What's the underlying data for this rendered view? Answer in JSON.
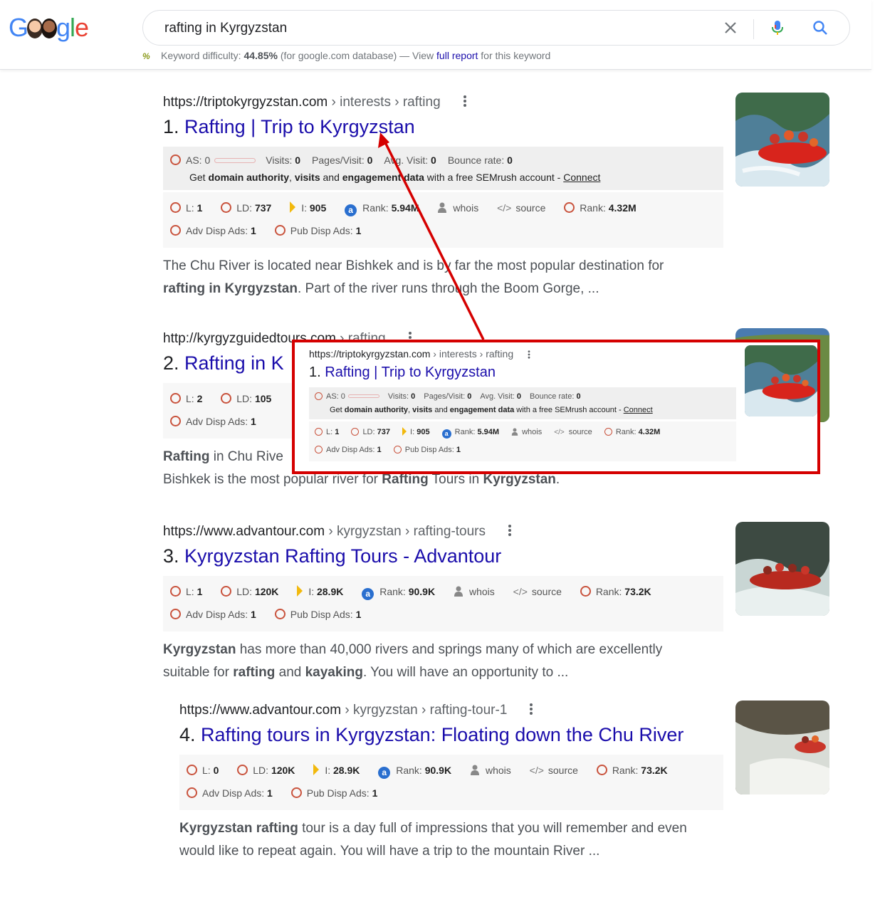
{
  "search": {
    "query": "rafting in Kyrgyzstan",
    "keyword_difficulty_label": "Keyword difficulty:",
    "keyword_difficulty_value": "44.85%",
    "keyword_db_note": "(for google.com database) — View",
    "full_report_link": "full report",
    "keyword_suffix": "for this keyword"
  },
  "logo": {
    "letters": [
      "G",
      "o",
      "o",
      "g",
      "l",
      "e"
    ]
  },
  "results": [
    {
      "domain": "https://triptokyrgyzstan.com",
      "path": " › interests › rafting",
      "number": "1.",
      "title": "Rafting | Trip to Kyrgyzstan",
      "seo_top": {
        "as_label": "AS: 0",
        "visits_label": "Visits:",
        "visits_value": "0",
        "pages_label": "Pages/Visit:",
        "pages_value": "0",
        "avg_label": "Avg. Visit:",
        "avg_value": "0",
        "bounce_label": "Bounce rate:",
        "bounce_value": "0",
        "promo_pre": "Get ",
        "promo_b1": "domain authority",
        "promo_mid1": ", ",
        "promo_b2": "visits",
        "promo_mid2": " and ",
        "promo_b3": "engagement data",
        "promo_post": " with a free SEMrush account - ",
        "connect": "Connect"
      },
      "metrics": {
        "l_label": "L:",
        "l_value": "1",
        "ld_label": "LD:",
        "ld_value": "737",
        "i_label": "I:",
        "i_value": "905",
        "rank_label": "Rank:",
        "rank_value": "5.94M",
        "whois": "whois",
        "source": "source",
        "rank2_label": "Rank:",
        "rank2_value": "4.32M",
        "adv_label": "Adv Disp Ads:",
        "adv_value": "1",
        "pub_label": "Pub Disp Ads:",
        "pub_value": "1"
      },
      "snippet_1": "The Chu River is located near Bishkek and is by far the most popular destination for",
      "snippet_2b": "rafting in Kyrgyzstan",
      "snippet_2": ". Part of the river runs through the Boom Gorge, ..."
    },
    {
      "domain": "http://kyrgyzguidedtours.com",
      "path": " › rafting",
      "number": "2.",
      "title": "Rafting in K",
      "metrics": {
        "l_label": "L:",
        "l_value": "2",
        "ld_label": "LD:",
        "ld_value": "105",
        "adv_label": "Adv Disp Ads:",
        "adv_value": "1"
      },
      "snippet_1b": "Rafting",
      "snippet_1": " in Chu Rive",
      "snippet_2a": "Bishkek is the most popular river for ",
      "snippet_2b": "Rafting",
      "snippet_2c": " Tours in ",
      "snippet_2d": "Kyrgyzstan",
      "snippet_2e": "."
    },
    {
      "domain": "https://www.advantour.com",
      "path": " › kyrgyzstan › rafting-tours",
      "number": "3.",
      "title": "Kyrgyzstan Rafting Tours - Advantour",
      "metrics": {
        "l_label": "L:",
        "l_value": "1",
        "ld_label": "LD:",
        "ld_value": "120K",
        "i_label": "I:",
        "i_value": "28.9K",
        "rank_label": "Rank:",
        "rank_value": "90.9K",
        "whois": "whois",
        "source": "source",
        "rank2_label": "Rank:",
        "rank2_value": "73.2K",
        "adv_label": "Adv Disp Ads:",
        "adv_value": "1",
        "pub_label": "Pub Disp Ads:",
        "pub_value": "1"
      },
      "snippet_1b": "Kyrgyzstan",
      "snippet_1": " has more than 40,000 rivers and springs many of which are excellently",
      "snippet_2a": "suitable for ",
      "snippet_2b": "rafting",
      "snippet_2c": " and ",
      "snippet_2d": "kayaking",
      "snippet_2e": ". You will have an opportunity to ..."
    },
    {
      "domain": "https://www.advantour.com",
      "path": " › kyrgyzstan › rafting-tour-1",
      "number": "4.",
      "title": "Rafting tours in Kyrgyzstan: Floating down the Chu River",
      "metrics": {
        "l_label": "L:",
        "l_value": "0",
        "ld_label": "LD:",
        "ld_value": "120K",
        "i_label": "I:",
        "i_value": "28.9K",
        "rank_label": "Rank:",
        "rank_value": "90.9K",
        "whois": "whois",
        "source": "source",
        "rank2_label": "Rank:",
        "rank2_value": "73.2K",
        "adv_label": "Adv Disp Ads:",
        "adv_value": "1",
        "pub_label": "Pub Disp Ads:",
        "pub_value": "1"
      },
      "snippet_1b": "Kyrgyzstan rafting",
      "snippet_1": " tour is a day full of impressions that you will remember and even",
      "snippet_2": "would like to repeat again. You will have a trip to the mountain River ..."
    }
  ],
  "colors": {
    "link": "#1a0dab",
    "callout_border": "#d50000",
    "ring": "#c9533d"
  }
}
